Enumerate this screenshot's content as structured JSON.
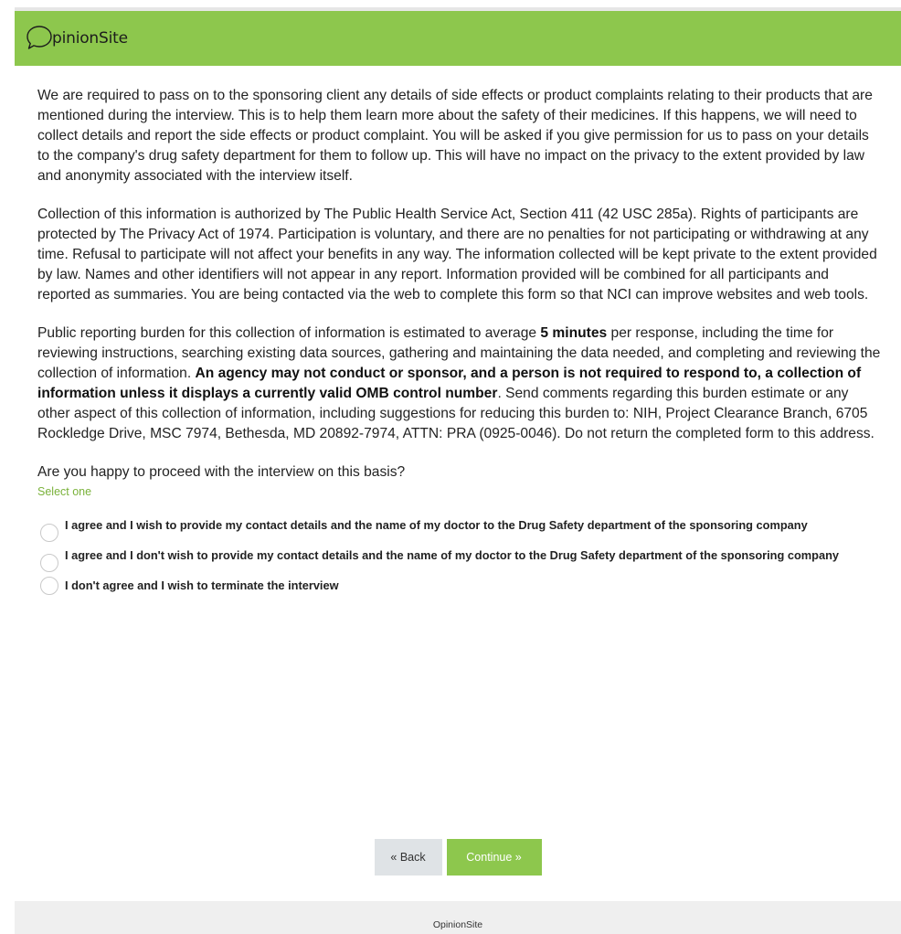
{
  "brand": {
    "logo_text": "pinionSite",
    "accent_color": "#8dc74d",
    "logo_icon": "speech-bubble-icon"
  },
  "content": {
    "paragraph1": "We are required to pass on to the sponsoring client any details of side effects or product complaints relating to their products that are mentioned during the interview. This is to help them learn more about the safety of their medicines. If this happens, we will need to collect details and report the side effects or product complaint. You will be asked if you give permission for us to pass on your details to the company's drug safety department for them to follow up. This will have no impact on the privacy to the extent provided by law and anonymity associated with the interview itself.",
    "paragraph2": "Collection of this information is authorized by The Public Health Service Act, Section 411 (42 USC 285a). Rights of participants are protected by The Privacy Act of 1974. Participation is voluntary, and there are no penalties for not participating or withdrawing at any time. Refusal to participate will not affect your benefits in any way. The information collected will be kept private to the extent provided by law. Names and other identifiers will not appear in any report. Information provided will be combined for all participants and reported as summaries. You are being contacted via the web to complete this form so that NCI can improve websites and web tools.",
    "paragraph3": {
      "part1": "Public reporting burden for this collection of information is estimated to average ",
      "bold1": "5 minutes",
      "part2": " per response, including the time for reviewing instructions, searching existing data sources, gathering and maintaining the data needed, and completing and reviewing the collection of information. ",
      "bold2": "An agency may not conduct or sponsor, and a person is not required to respond to, a collection of information unless it displays a currently valid OMB control number",
      "part3": ". Send comments regarding this burden estimate or any other aspect of this collection of information, including suggestions for reducing this burden to: NIH, Project Clearance Branch, 6705 Rockledge Drive, MSC 7974, Bethesda, MD 20892-7974, ATTN: PRA (0925-0046). Do not return the completed form to this address."
    },
    "question": "Are you happy to proceed with the interview on this basis?",
    "hint": "Select one",
    "options": [
      {
        "label": "I agree and I wish to provide my contact details and the name of my doctor to the Drug Safety department of the sponsoring company",
        "selected": false
      },
      {
        "label": "I agree and I don't wish to provide my contact details and the name of my doctor to the Drug Safety department of the sponsoring company",
        "selected": false
      },
      {
        "label": "I don't agree and I wish to terminate the interview",
        "selected": false
      }
    ]
  },
  "buttons": {
    "back_label": "« Back",
    "continue_label": "Continue »"
  },
  "footer": {
    "text": "OpinionSite"
  }
}
